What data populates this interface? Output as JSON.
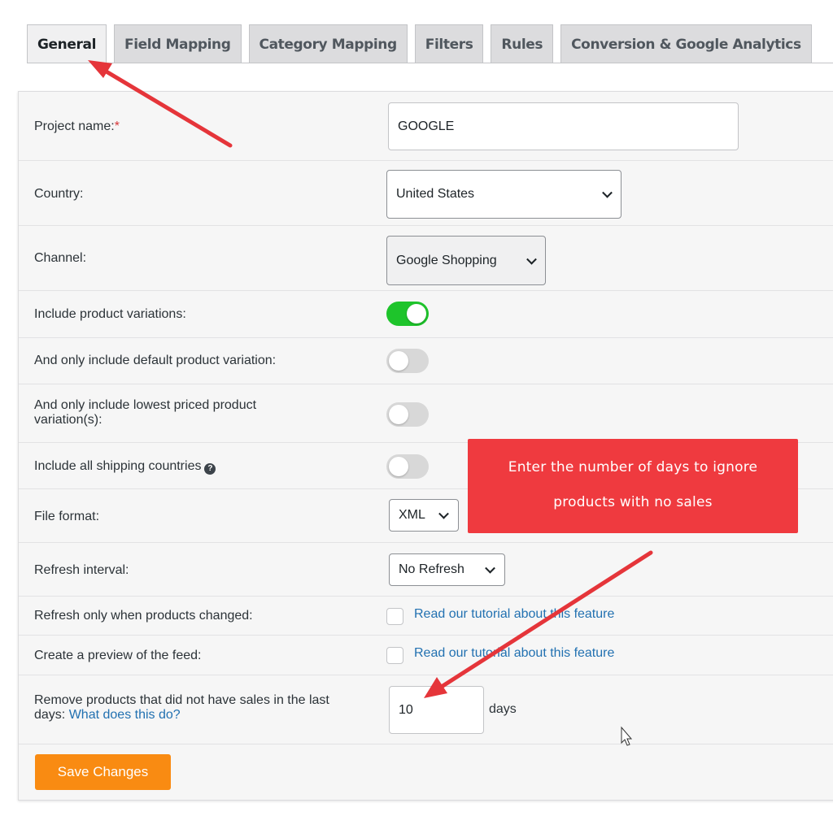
{
  "tabs": [
    {
      "label": "General",
      "active": true
    },
    {
      "label": "Field Mapping",
      "active": false
    },
    {
      "label": "Category Mapping",
      "active": false
    },
    {
      "label": "Filters",
      "active": false
    },
    {
      "label": "Rules",
      "active": false
    },
    {
      "label": "Conversion & Google Analytics",
      "active": false
    }
  ],
  "form": {
    "project_name": {
      "label": "Project name:",
      "required_marker": "*",
      "value": "GOOGLE"
    },
    "country": {
      "label": "Country:",
      "value": "United States"
    },
    "channel": {
      "label": "Channel:",
      "value": "Google Shopping"
    },
    "include_variations": {
      "label": "Include product variations:",
      "on": true
    },
    "default_variation": {
      "label": "And only include default product variation:",
      "on": false
    },
    "lowest_priced": {
      "label": "And only include lowest priced product variation(s):",
      "on": false
    },
    "shipping_countries": {
      "label": "Include all shipping countries",
      "help_icon": "question-circle-icon",
      "on": false
    },
    "file_format": {
      "label": "File format:",
      "value": "XML"
    },
    "refresh_interval": {
      "label": "Refresh interval:",
      "value": "No Refresh"
    },
    "refresh_changed": {
      "label": "Refresh only when products changed:",
      "checked": false,
      "link": "Read our tutorial about this feature"
    },
    "preview": {
      "label": "Create a preview of the feed:",
      "checked": false,
      "link": "Read our tutorial about this feature"
    },
    "remove_products": {
      "label": "Remove products that did not have sales in the last days:",
      "link": "What does this do?",
      "value": "10",
      "unit": "days"
    }
  },
  "save_label": "Save Changes",
  "callout": {
    "line1": "Enter the number of days to ignore",
    "line2": "products with no sales"
  },
  "colors": {
    "accent_orange": "#f98b12",
    "toggle_on": "#1ec42b",
    "annotation_red": "#ef3a3f",
    "link_blue": "#2271b1"
  }
}
